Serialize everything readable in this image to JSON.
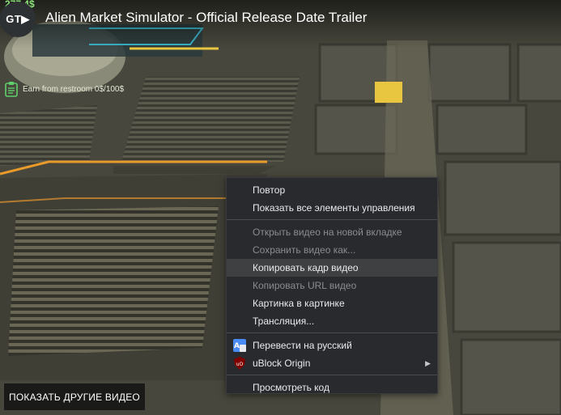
{
  "video": {
    "title": "Alien Market Simulator - Official Release Date Trailer",
    "channel_logo_text": "GT▶",
    "hud_money": "277.4$",
    "hud_task": "Earn from restroom 0$/100$",
    "more_videos_button": "ПОКАЗАТЬ ДРУГИЕ ВИДЕО"
  },
  "context_menu": {
    "items": [
      {
        "label": "Повтор",
        "enabled": true
      },
      {
        "label": "Показать все элементы управления",
        "enabled": true
      },
      {
        "label": "Открыть видео на новой вкладке",
        "enabled": false
      },
      {
        "label": "Сохранить видео как...",
        "enabled": false
      },
      {
        "label": "Копировать кадр видео",
        "enabled": true,
        "highlighted": true
      },
      {
        "label": "Копировать URL видео",
        "enabled": false
      },
      {
        "label": "Картинка в картинке",
        "enabled": true
      },
      {
        "label": "Трансляция...",
        "enabled": true
      },
      {
        "label": "Перевести на русский",
        "enabled": true,
        "icon": "google-translate-icon"
      },
      {
        "label": "uBlock Origin",
        "enabled": true,
        "icon": "ublock-origin-icon",
        "submenu": true
      },
      {
        "label": "Просмотреть код",
        "enabled": true
      }
    ],
    "submenu_arrow": "▶"
  },
  "colors": {
    "menu_bg": "#292a2d",
    "menu_highlight": "#3f4042",
    "hud_yellow": "#e8c640",
    "hud_cyan": "#39b3c7"
  }
}
